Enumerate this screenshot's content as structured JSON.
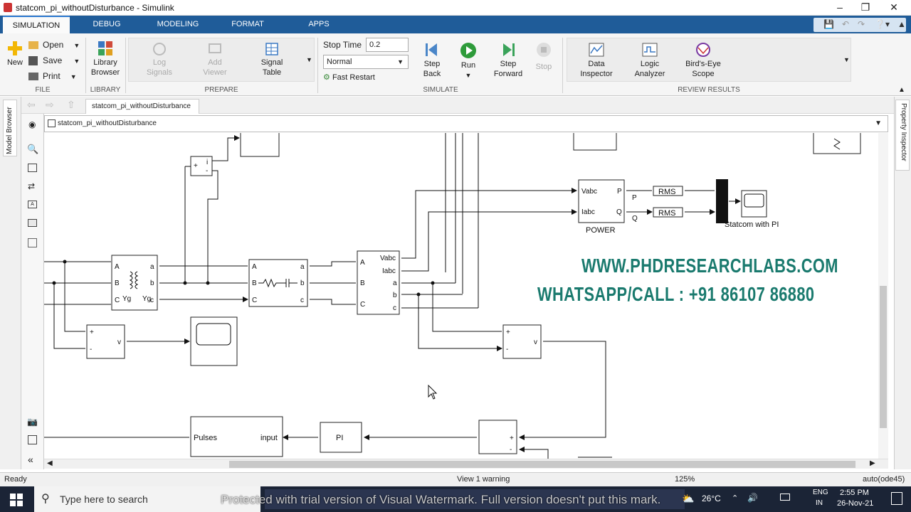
{
  "window": {
    "title": "statcom_pi_withoutDisturbance - Simulink"
  },
  "tabs": [
    {
      "label": "SIMULATION",
      "active": true
    },
    {
      "label": "DEBUG"
    },
    {
      "label": "MODELING"
    },
    {
      "label": "FORMAT"
    },
    {
      "label": "APPS"
    }
  ],
  "ribbon": {
    "file": {
      "new": "New",
      "open": "Open",
      "save": "Save",
      "print": "Print",
      "section": "FILE"
    },
    "library": {
      "browser_line1": "Library",
      "browser_line2": "Browser",
      "section": "LIBRARY"
    },
    "prepare": {
      "log1": "Log",
      "log2": "Signals",
      "add1": "Add",
      "add2": "Viewer",
      "sig1": "Signal",
      "sig2": "Table",
      "section": "PREPARE"
    },
    "simulate": {
      "stop_time_label": "Stop Time",
      "stop_time_value": "0.2",
      "mode_value": "Normal",
      "fast_restart": "Fast Restart",
      "stepback1": "Step",
      "stepback2": "Back",
      "run": "Run",
      "stepfwd1": "Step",
      "stepfwd2": "Forward",
      "stop": "Stop",
      "section": "SIMULATE"
    },
    "review": {
      "data1": "Data",
      "data2": "Inspector",
      "logic1": "Logic",
      "logic2": "Analyzer",
      "bird1": "Bird's-Eye",
      "bird2": "Scope",
      "section": "REVIEW RESULTS"
    }
  },
  "editor": {
    "tab_label": "statcom_pi_withoutDisturbance",
    "path": "statcom_pi_withoutDisturbance",
    "model_browser": "Model Browser",
    "property_inspector": "Property Inspector"
  },
  "diagram": {
    "power_in1": "Vabc",
    "power_in2": "Iabc",
    "power_out1": "P",
    "power_out2": "Q",
    "power_name": "POWER",
    "p_label": "P",
    "q_label": "Q",
    "rms1": "RMS",
    "rms2": "RMS",
    "scope_name": "Statcom with PI",
    "pulses": "Pulses",
    "input": "input",
    "pi": "PI",
    "plus": "+",
    "minus": "-",
    "v": "v",
    "i": "i",
    "meas_vabc": "Vabc",
    "meas_iabc": "Iabc",
    "A": "A",
    "B": "B",
    "C": "C",
    "a": "a",
    "b": "b",
    "c": "c",
    "yg": "Yg"
  },
  "promo": {
    "line1": "WWW.PHDRESEARCHLABS.COM",
    "line2": "WHATSAPP/CALL : +91 86107 86880"
  },
  "status": {
    "left": "Ready",
    "center": "View 1 warning",
    "zoom": "125%",
    "solver": "auto(ode45)"
  },
  "taskbar": {
    "search_placeholder": "Type here to search",
    "weather": "26°C",
    "lang1": "ENG",
    "lang2": "IN",
    "time": "2:55 PM",
    "date": "26-Nov-21",
    "watermark": "Protected with trial version of Visual Watermark. Full version doesn't put this mark."
  },
  "colors": {
    "tabbar": "#1f5c99",
    "promo": "#1a7a6e",
    "taskbar": "#1b2436"
  }
}
